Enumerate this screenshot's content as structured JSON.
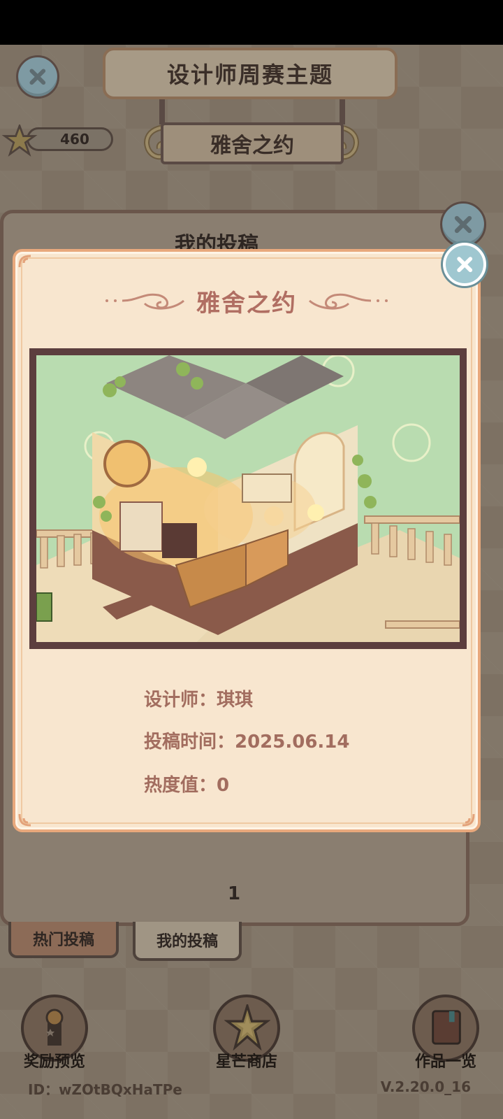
{
  "header": {
    "banner_title": "设计师周赛主题",
    "theme_name": "雅舍之约",
    "stars": "460"
  },
  "back_panel": {
    "title": "我的投稿",
    "page_number": "1"
  },
  "tabs": [
    {
      "label": "热门投稿"
    },
    {
      "label": "我的投稿"
    }
  ],
  "bottom_nav": [
    {
      "label": "奖励预览",
      "icon": "trophy-icon"
    },
    {
      "label": "星芒商店",
      "icon": "star-shop-icon"
    },
    {
      "label": "作品一览",
      "icon": "book-icon"
    }
  ],
  "footer": {
    "id": "ID：wZOtBQxHaTPe",
    "version": "V.2.20.0_16"
  },
  "modal": {
    "title": "雅舍之约",
    "designer": "设计师：琪琪",
    "submit_time": "投稿时间：2025.06.14",
    "heat": "热度值：0"
  },
  "colors": {
    "modal_bg": "#f8e6cf",
    "modal_border": "#e8a87c",
    "title_color": "#b06e62",
    "info_color": "#a26d5f",
    "frame_color": "#5c3e3e",
    "scene_bg": "#b9dcb0"
  }
}
